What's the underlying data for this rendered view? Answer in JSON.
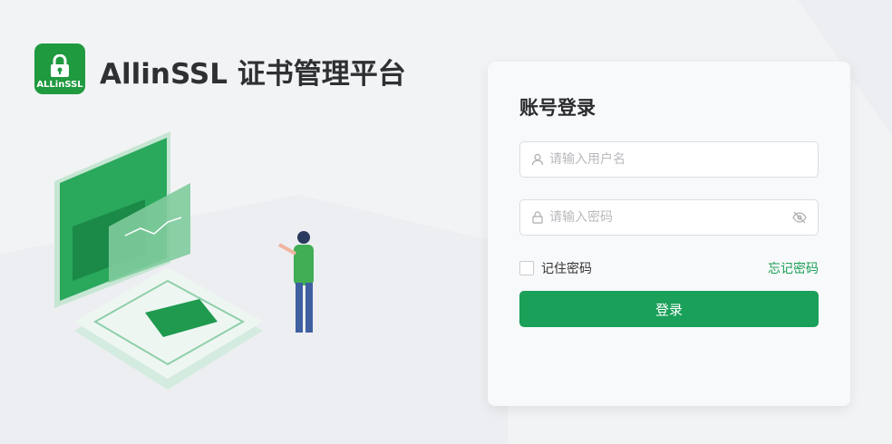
{
  "brand": {
    "logo_text": "ALLinSSL",
    "title": "AllinSSL 证书管理平台"
  },
  "login": {
    "heading": "账号登录",
    "username": {
      "placeholder": "请输入用户名",
      "value": ""
    },
    "password": {
      "placeholder": "请输入密码",
      "value": ""
    },
    "remember_label": "记住密码",
    "forgot_label": "忘记密码",
    "submit_label": "登录"
  },
  "colors": {
    "accent": "#1aa059",
    "logo": "#1f9a3f"
  }
}
